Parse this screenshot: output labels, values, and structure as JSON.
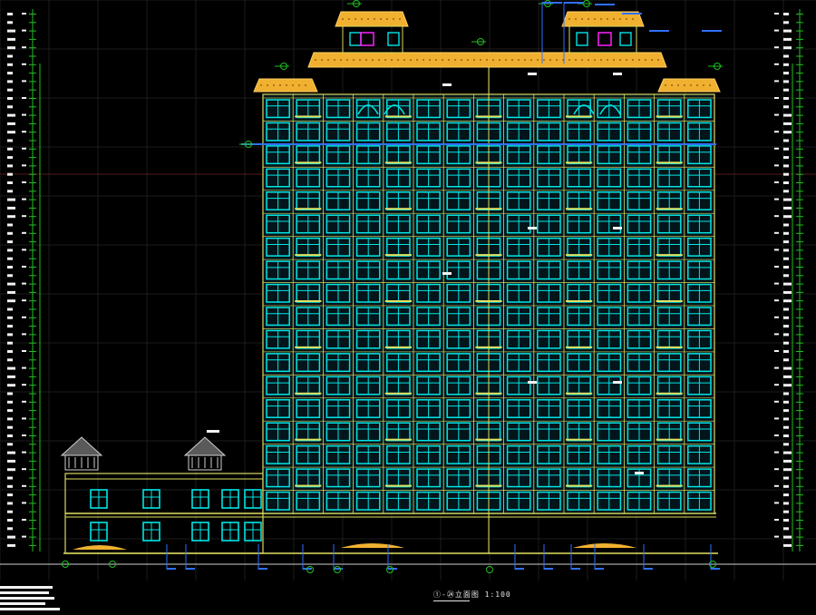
{
  "drawing": {
    "caption": "①-㉔立面图 1:100",
    "colors": {
      "background": "#000000",
      "grid": "#1c1c1c",
      "window_frame": "#00e5e5",
      "wall_line": "#d8d860",
      "slab_line": "#e0e060",
      "roof_tile": "#f0b030",
      "dimension": "#20c020",
      "level_marker": "#3070ff",
      "text": "#ffffff",
      "accent": "#ff20ff"
    },
    "elevation": {
      "floors": 18,
      "podium_floors": 2,
      "tower_bays": 15,
      "pavilion_roofs": 2
    }
  }
}
